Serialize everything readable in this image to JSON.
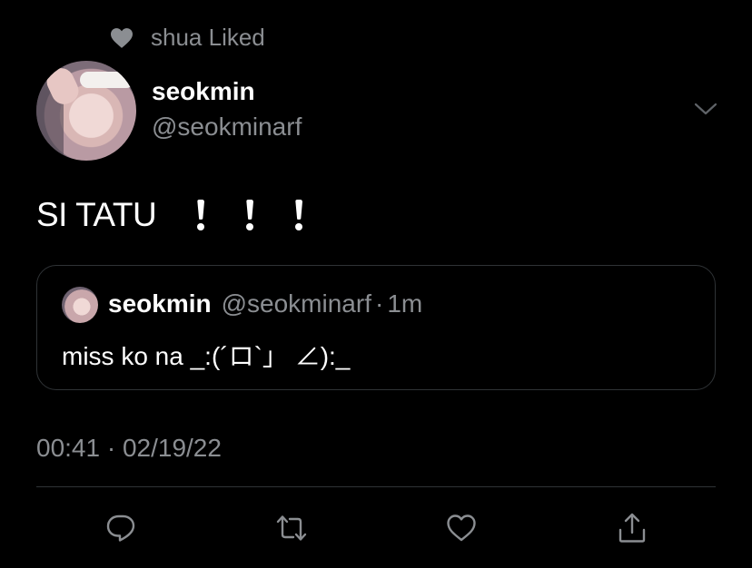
{
  "social_context": {
    "icon": "heart-icon",
    "text": "shua Liked"
  },
  "author": {
    "name": "seokmin",
    "handle": "@seokminarf"
  },
  "tweet": {
    "text": "SI TATU",
    "emoji": [
      "❗",
      "❗",
      "❗"
    ]
  },
  "quoted_tweet": {
    "name": "seokmin",
    "handle": "@seokminarf",
    "separator": "·",
    "time": "1m",
    "text": "miss ko na _:(´ロ`」 ∠):_"
  },
  "timestamp": "00:41 · 02/19/22",
  "actions": [
    {
      "icon": "reply-icon"
    },
    {
      "icon": "retweet-icon"
    },
    {
      "icon": "like-icon"
    },
    {
      "icon": "share-icon"
    }
  ],
  "colors": {
    "background": "#000000",
    "text": "#ffffff",
    "secondary": "#8b8e92",
    "border": "#2f3336"
  }
}
